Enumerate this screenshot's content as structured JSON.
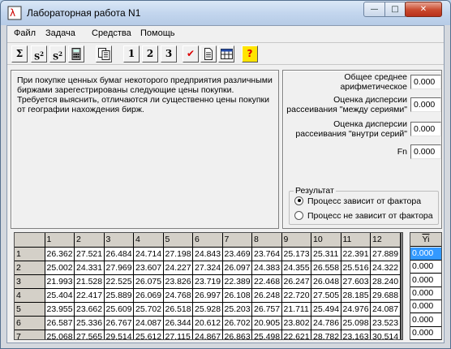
{
  "window": {
    "title": "Лабораторная работа N1"
  },
  "menu": [
    "Файл",
    "Задача",
    "Средства",
    "Помощь"
  ],
  "toolbar": {
    "digit_buttons": [
      "1",
      "2",
      "3"
    ]
  },
  "description": "При покупке ценных бумаг некоторого предприятия различными биржами зарегестрированы следующие цены покупки. Требуется выяснить, отличаются ли существенно цены покупки от географии нахождения бирж.",
  "stats": [
    {
      "label": "Общее среднее арифметическое",
      "value": "0.000"
    },
    {
      "label": "Оценка дисперсии рассеивания \"между сериями\"",
      "value": "0.000"
    },
    {
      "label": "Оценка дисперсии рассеивания \"внутри серий\"",
      "value": "0.000"
    },
    {
      "label": "Fn",
      "value": "0.000"
    }
  ],
  "result": {
    "title": "Результат",
    "options": [
      "Процесс зависит от фактора",
      "Процесс не зависит от фактора"
    ],
    "selected_index": 0
  },
  "grid": {
    "columns": [
      "1",
      "2",
      "3",
      "4",
      "5",
      "6",
      "7",
      "8",
      "9",
      "10",
      "11",
      "12"
    ],
    "rows": [
      {
        "label": "1",
        "values": [
          "26.362",
          "27.521",
          "26.484",
          "24.714",
          "27.198",
          "24.843",
          "23.469",
          "23.764",
          "25.173",
          "25.311",
          "22.391",
          "27.889"
        ]
      },
      {
        "label": "2",
        "values": [
          "25.002",
          "24.331",
          "27.969",
          "23.607",
          "24.227",
          "27.324",
          "26.097",
          "24.383",
          "24.355",
          "26.558",
          "25.516",
          "24.322"
        ]
      },
      {
        "label": "3",
        "values": [
          "21.993",
          "21.528",
          "22.525",
          "26.075",
          "23.826",
          "23.719",
          "22.389",
          "22.468",
          "26.247",
          "26.048",
          "27.603",
          "28.240"
        ]
      },
      {
        "label": "4",
        "values": [
          "25.404",
          "22.417",
          "25.889",
          "26.069",
          "24.768",
          "26.997",
          "26.108",
          "26.248",
          "22.720",
          "27.505",
          "28.185",
          "29.688"
        ]
      },
      {
        "label": "5",
        "values": [
          "23.955",
          "23.662",
          "25.609",
          "25.702",
          "26.518",
          "25.928",
          "25.203",
          "26.757",
          "21.711",
          "25.494",
          "24.976",
          "24.087"
        ]
      },
      {
        "label": "6",
        "values": [
          "26.587",
          "25.336",
          "26.767",
          "24.087",
          "26.344",
          "20.612",
          "26.702",
          "20.905",
          "23.802",
          "24.786",
          "25.098",
          "23.523"
        ]
      },
      {
        "label": "7",
        "values": [
          "25.068",
          "27.565",
          "29.514",
          "25.612",
          "27.115",
          "24.867",
          "26.863",
          "25.498",
          "22.621",
          "28.782",
          "23.163",
          "30.514"
        ]
      }
    ]
  },
  "yi": {
    "header": "Yi",
    "values": [
      "0.000",
      "0.000",
      "0.000",
      "0.000",
      "0.000",
      "0.000",
      "0.000"
    ],
    "selected_index": 0
  }
}
